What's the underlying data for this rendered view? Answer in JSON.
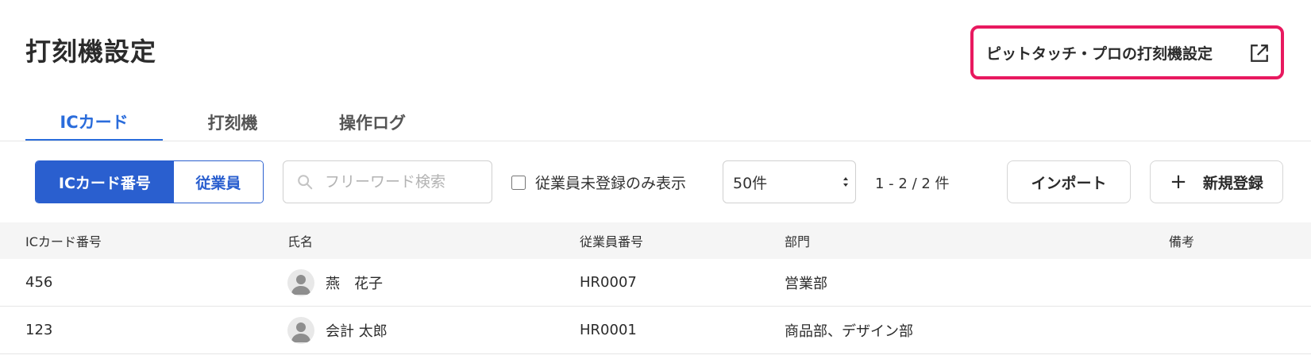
{
  "header": {
    "title": "打刻機設定",
    "external_link_label": "ピットタッチ・プロの打刻機設定"
  },
  "tabs": [
    {
      "label": "ICカード",
      "active": true
    },
    {
      "label": "打刻機",
      "active": false
    },
    {
      "label": "操作ログ",
      "active": false
    }
  ],
  "toolbar": {
    "segment": [
      {
        "label": "ICカード番号",
        "selected": true
      },
      {
        "label": "従業員",
        "selected": false
      }
    ],
    "search_placeholder": "フリーワード検索",
    "search_value": "",
    "filter_label": "従業員未登録のみ表示",
    "filter_checked": false,
    "per_page": "50件",
    "count": "1 - 2 / 2  件",
    "import_label": "インポート",
    "new_label": "新規登録"
  },
  "table": {
    "columns": [
      "ICカード番号",
      "氏名",
      "従業員番号",
      "部門",
      "備考"
    ],
    "rows": [
      {
        "card": "456",
        "name": "燕　花子",
        "emp_no": "HR0007",
        "dept": "営業部",
        "note": ""
      },
      {
        "card": "123",
        "name": "会計 太郎",
        "emp_no": "HR0001",
        "dept": "商品部、デザイン部",
        "note": ""
      }
    ]
  },
  "colors": {
    "accent": "#2a5fcf",
    "tab_active": "#2a6cdb",
    "highlight": "#e8195f"
  },
  "icons": {
    "external": "external-link-icon",
    "search": "search-icon",
    "plus": "plus-icon",
    "avatar": "user-avatar-icon",
    "select": "select-arrows-icon"
  }
}
